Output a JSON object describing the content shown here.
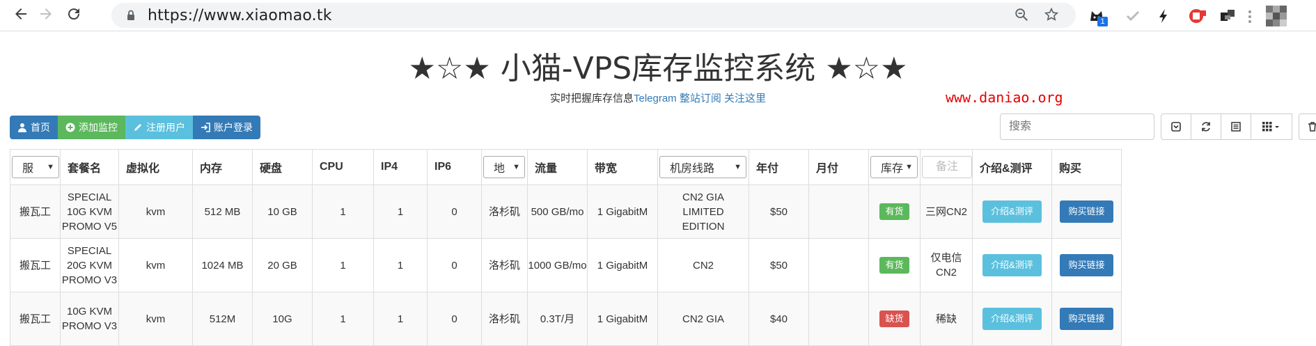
{
  "browser": {
    "url": "https://www.xiaomao.tk",
    "extension_badge": "1"
  },
  "page": {
    "title": "★☆★ 小猫-VPS库存监控系统 ★☆★",
    "subtitle_text": "实时把握库存信息",
    "subtitle_link": "Telegram 整站订阅 关注这里",
    "watermark": "www.daniao.org"
  },
  "toolbar": {
    "home": "首页",
    "add_monitor": "添加监控",
    "register": "注册用户",
    "login": "账户登录",
    "search_placeholder": "搜索"
  },
  "table": {
    "columns": {
      "provider_filter": "服",
      "plan": "套餐名",
      "virt": "虚拟化",
      "ram": "内存",
      "disk": "硬盘",
      "cpu": "CPU",
      "ip4": "IP4",
      "ip6": "IP6",
      "location_filter": "地",
      "traffic": "流量",
      "bandwidth": "带宽",
      "route_filter": "机房线路",
      "yearly": "年付",
      "monthly": "月付",
      "stock_filter": "库存",
      "note_filter": "备注",
      "review": "介绍&测评",
      "buy": "购买"
    },
    "rows": [
      {
        "provider": "搬瓦工",
        "plan": "SPECIAL 10G KVM PROMO V5",
        "virt": "kvm",
        "ram": "512 MB",
        "disk": "10 GB",
        "cpu": "1",
        "ip4": "1",
        "ip6": "0",
        "location": "洛杉矶",
        "traffic": "500 GB/mo",
        "bandwidth": "1 GigabitM",
        "route": "CN2 GIA LIMITED EDITION",
        "yearly": "$50",
        "monthly": "",
        "stock": "有货",
        "note": "三网CN2",
        "review": "介绍&测评",
        "buy": "购买链接"
      },
      {
        "provider": "搬瓦工",
        "plan": "SPECIAL 20G KVM PROMO V3",
        "virt": "kvm",
        "ram": "1024 MB",
        "disk": "20 GB",
        "cpu": "1",
        "ip4": "1",
        "ip6": "0",
        "location": "洛杉矶",
        "traffic": "1000 GB/mo",
        "bandwidth": "1 GigabitM",
        "route": "CN2",
        "yearly": "$50",
        "monthly": "",
        "stock": "有货",
        "note": "仅电信CN2",
        "review": "介绍&测评",
        "buy": "购买链接"
      },
      {
        "provider": "搬瓦工",
        "plan": "10G KVM PROMO V3",
        "virt": "kvm",
        "ram": "512M",
        "disk": "10G",
        "cpu": "1",
        "ip4": "1",
        "ip6": "0",
        "location": "洛杉矶",
        "traffic": "0.3T/月",
        "bandwidth": "1 GigabitM",
        "route": "CN2 GIA",
        "yearly": "$40",
        "monthly": "",
        "stock": "缺货",
        "note": "稀缺",
        "review": "介绍&测评",
        "buy": "购买链接"
      }
    ]
  },
  "colors": {
    "primary": "#337ab7",
    "success": "#5cb85c",
    "info": "#5bc0de",
    "danger": "#d9534f",
    "watermark": "#e60000"
  }
}
